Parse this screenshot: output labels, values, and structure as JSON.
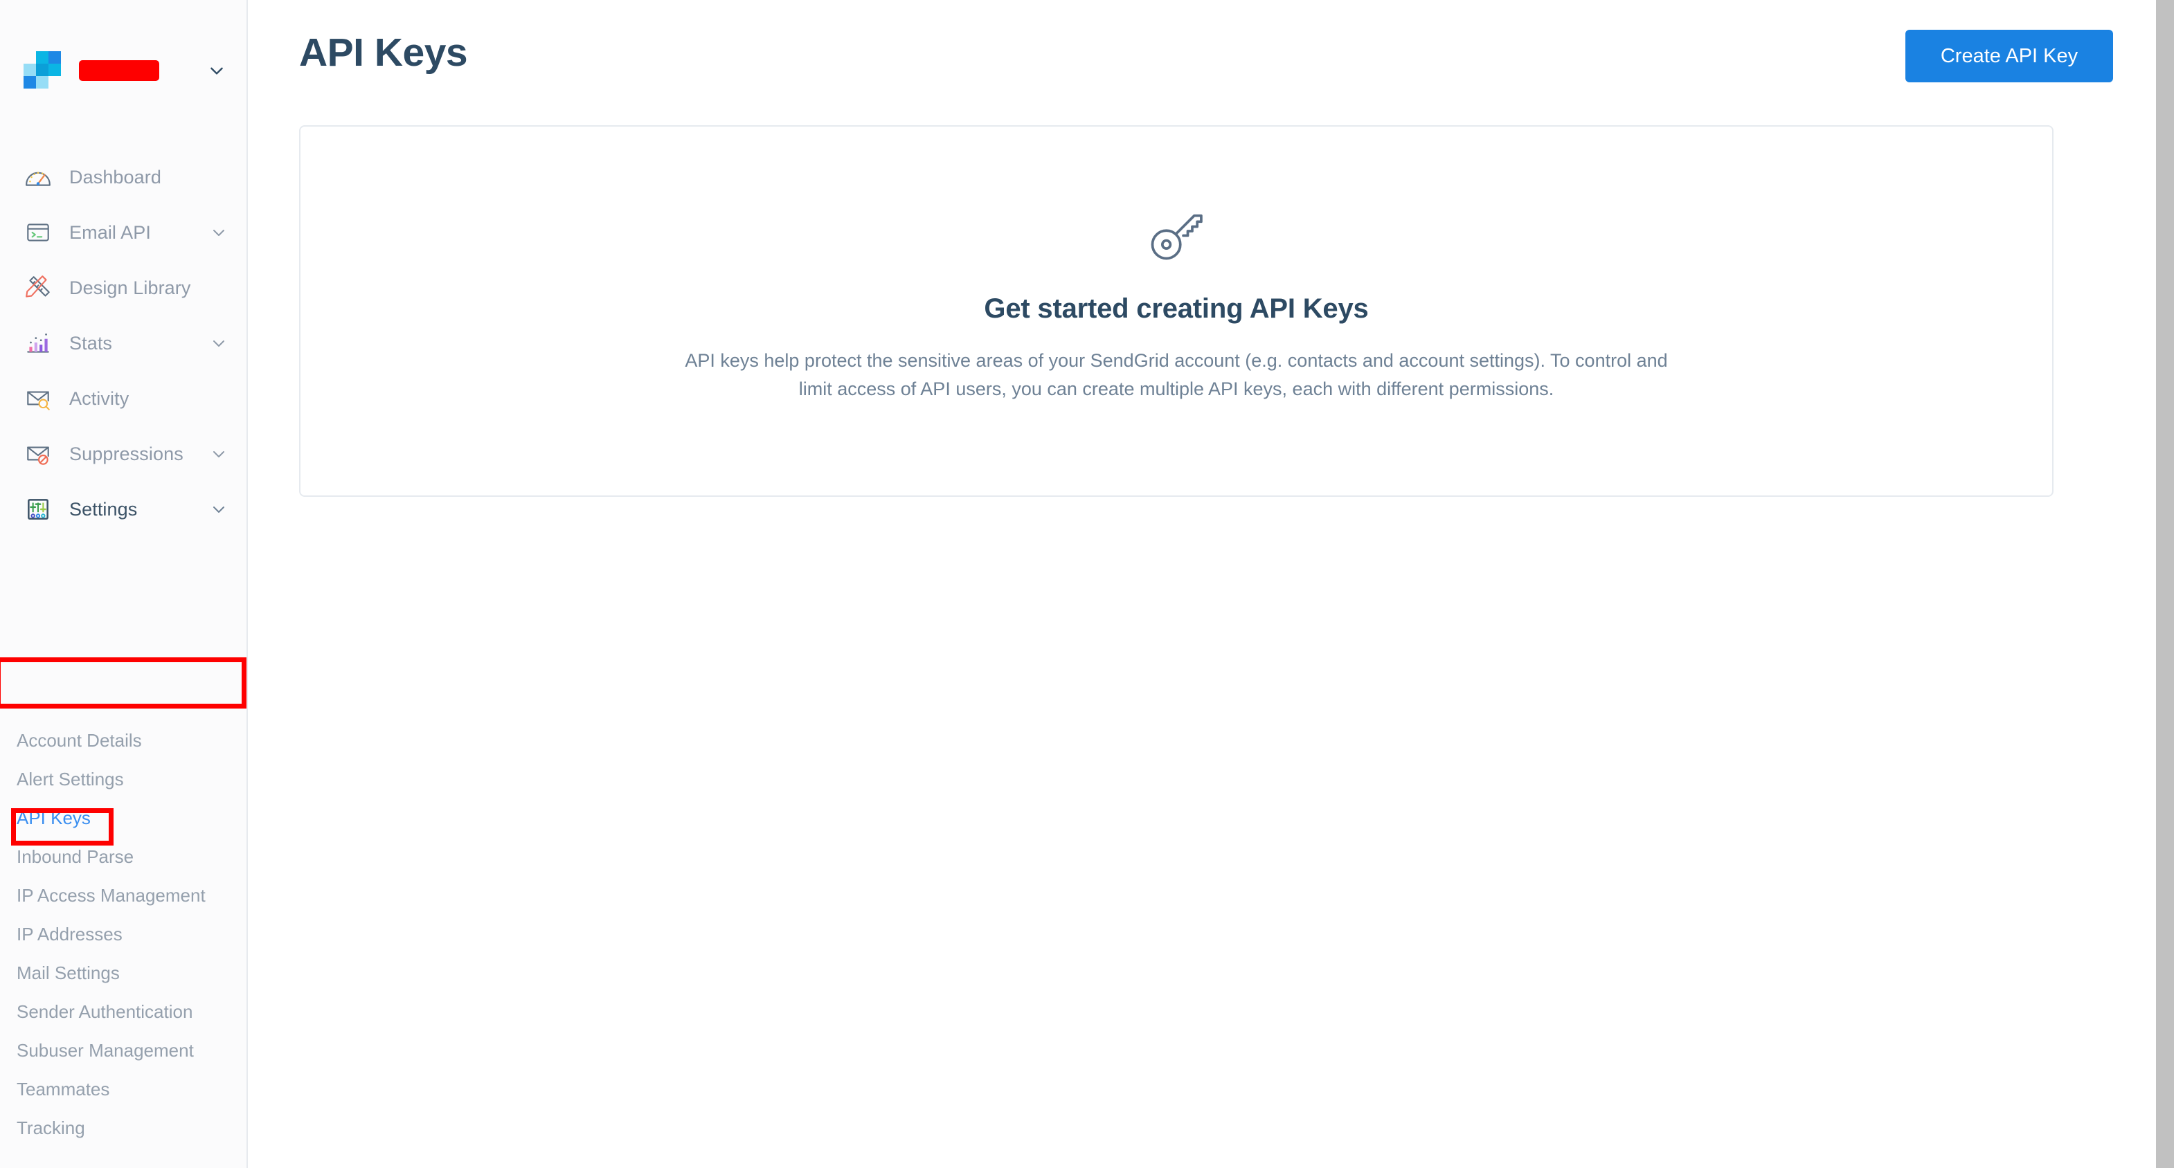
{
  "brand": {
    "logo_icon": "sendgrid-logo-icon",
    "account_name": "",
    "account_name_redacted": true,
    "caret_icon": "chevron-down-icon",
    "logo_colors": {
      "cyan": "#0bb5e4",
      "blue": "#1e88e5",
      "light_blue": "#96ddf6",
      "mid_blue": "#0b9fd8"
    }
  },
  "sidebar": {
    "items": [
      {
        "label": "Dashboard",
        "icon": "dashboard-gauge-icon",
        "expandable": false
      },
      {
        "label": "Email API",
        "icon": "terminal-window-icon",
        "expandable": true
      },
      {
        "label": "Design Library",
        "icon": "pencil-ruler-icon",
        "expandable": false
      },
      {
        "label": "Stats",
        "icon": "bar-chart-icon",
        "expandable": true
      },
      {
        "label": "Activity",
        "icon": "envelope-search-icon",
        "expandable": false
      },
      {
        "label": "Suppressions",
        "icon": "envelope-blocked-icon",
        "expandable": true
      },
      {
        "label": "Settings",
        "icon": "sliders-settings-icon",
        "expandable": true
      }
    ],
    "settings_subitems": [
      {
        "label": "Account Details",
        "active": false
      },
      {
        "label": "Alert Settings",
        "active": false
      },
      {
        "label": "API Keys",
        "active": true
      },
      {
        "label": "Inbound Parse",
        "active": false
      },
      {
        "label": "IP Access Management",
        "active": false
      },
      {
        "label": "IP Addresses",
        "active": false
      },
      {
        "label": "Mail Settings",
        "active": false
      },
      {
        "label": "Sender Authentication",
        "active": false
      },
      {
        "label": "Subuser Management",
        "active": false
      },
      {
        "label": "Teammates",
        "active": false
      },
      {
        "label": "Tracking",
        "active": false
      }
    ]
  },
  "header": {
    "title": "API Keys",
    "create_button_label": "Create API Key",
    "accent_color": "#1a82e2"
  },
  "empty_state": {
    "icon": "key-icon",
    "title": "Get started creating API Keys",
    "body": "API keys help protect the sensitive areas of your SendGrid account (e.g. contacts and account settings). To control and limit access of API users, you can create multiple API keys, each with different permissions."
  },
  "annotations": {
    "color": "#fe0000",
    "boxes": [
      {
        "target": "sidebar-item-settings"
      },
      {
        "target": "subnav-item-api-keys"
      }
    ]
  },
  "scrollbar": {
    "thumb_color": "#c1c1c1",
    "track_color": "#f2f2f2"
  }
}
